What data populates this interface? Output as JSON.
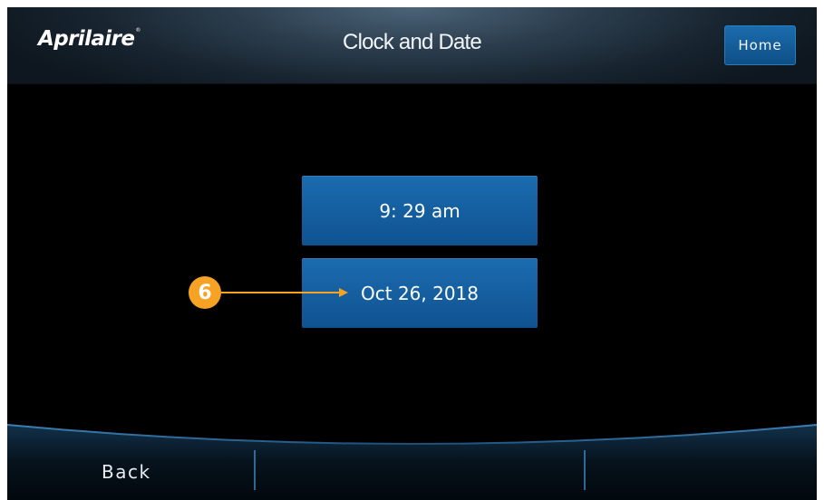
{
  "header": {
    "brand": "Aprilaire",
    "brand_mark": "®",
    "title": "Clock and Date",
    "home_label": "Home"
  },
  "main": {
    "time_value": "9: 29 am",
    "date_value": "Oct 26, 2018"
  },
  "annotation": {
    "callout_number": "6",
    "color": "#f5a225"
  },
  "footer": {
    "back_label": "Back"
  },
  "colors": {
    "accent_button": "#1565a8",
    "background": "#000000"
  }
}
